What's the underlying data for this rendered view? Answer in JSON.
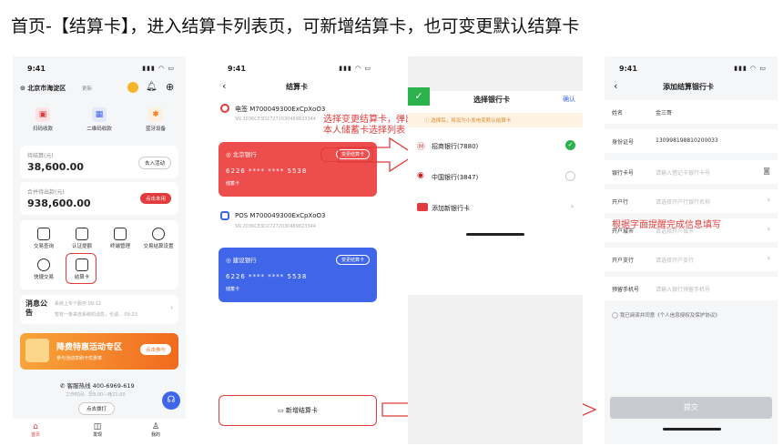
{
  "title": "首页-【结算卡】，进入结算卡列表页，可新增结算卡，也可变更默认结算卡",
  "status_time": "9:41",
  "p1": {
    "location": "北京市海淀区",
    "update": "更新",
    "quick": [
      "扫码收款",
      "二维码收款",
      "蓝牙设备"
    ],
    "wait_label": "待结算(元)",
    "wait_amount": "38,600.00",
    "wait_btn": "去入活动",
    "total_label": "合并待出款(元)",
    "total_amount": "938,600.00",
    "total_btn": "点击未用",
    "grid": [
      "交易查询",
      "认证提额",
      "终端管理",
      "交易结算设置",
      "快捷交易",
      "结算卡"
    ],
    "news_title": "消息公告",
    "news1": "系统上专个服务 09:12",
    "news2": "暂有一条来自系统的消息，也请... 09:23",
    "promo_title": "降费特惠活动专区",
    "promo_sub": "参与活动享刷卡优惠率",
    "promo_btn": "点击参与",
    "hotline": "客服热线 400-6969-619",
    "hours": "工作时间：早8:00—晚21:00",
    "call_btn": "点去拨打",
    "tabs": [
      "首页",
      "发现",
      "我的"
    ]
  },
  "p2": {
    "title": "结算卡",
    "dev1": "电签 M700049300ExCpXoO3",
    "sn1": "SN 2036CE3D27272030489823344",
    "bank1": "北京银行",
    "num1": "6226 **** **** 5538",
    "type1": "储蓄卡",
    "change": "变更结算卡",
    "dev2": "POS M700049300ExCpXoO3",
    "sn2": "SN 2036CE3D27272030489823344",
    "bank2": "建设银行",
    "num2": "6226 **** **** 5538",
    "type2": "储蓄卡",
    "add": "新增结算卡"
  },
  "annot1": "选择变更结算卡，弹出\n本人储蓄卡选择列表",
  "p3": {
    "title": "选择银行卡",
    "confirm": "确认",
    "notice": "选择后，将设为小发电变默认结算卡",
    "banks": [
      "招商银行(7880)",
      "中国银行(3847)"
    ],
    "add": "添加新银行卡"
  },
  "annot2": "根据字面提醒完成信息填写",
  "p4": {
    "title": "添加结算银行卡",
    "name_l": "姓名",
    "name_v": "金三哥",
    "id_l": "身份证号",
    "id_v": "130998198810200033",
    "fields": [
      {
        "l": "银行卡号",
        "p": "请输入借记卡银行卡号"
      },
      {
        "l": "开户行",
        "p": "请选择开户行银行名称"
      },
      {
        "l": "开户城市",
        "p": "请选择开户城市"
      },
      {
        "l": "开户支行",
        "p": "请选择开户支行"
      },
      {
        "l": "预留手机号",
        "p": "请输入银行预留手机号"
      }
    ],
    "agree": "我已阅读并同意《个人信息授权及保护协议》",
    "submit": "提交"
  },
  "colors": {
    "accent": "#e23b3b",
    "blue": "#3f66e8",
    "green": "#2bb24c",
    "orange": "#f57c1f"
  }
}
